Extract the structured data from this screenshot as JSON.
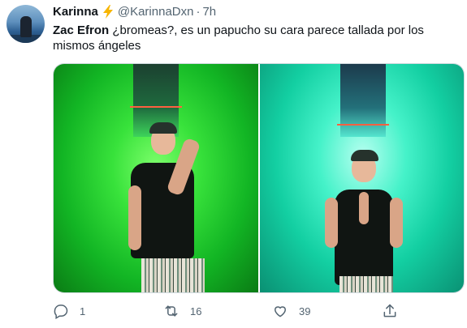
{
  "tweet": {
    "author": {
      "name": "Karinna",
      "handle": "@KarinnaDxn",
      "time": "7h",
      "badge_icon": "lightning-emoji"
    },
    "text": {
      "bold": "Zac Efron",
      "rest": " ¿bromeas?, es un papucho su cara parece tallada por los mismos ángeles"
    },
    "media": [
      {
        "description_icon": "photo-left"
      },
      {
        "description_icon": "photo-right"
      }
    ],
    "actions": {
      "replies": "1",
      "retweets": "16",
      "likes": "39"
    }
  },
  "colors": {
    "text_primary": "#0f1419",
    "text_secondary": "#536471",
    "lightning": "#f7b500",
    "photo_left": "#38e23b",
    "photo_right": "#13cfa2"
  }
}
